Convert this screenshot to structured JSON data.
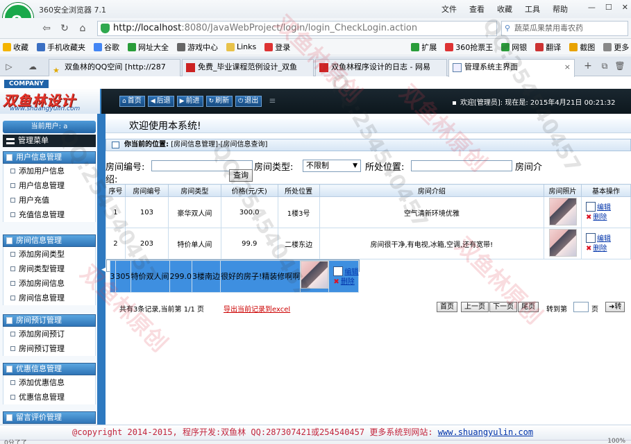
{
  "browser": {
    "app_title": "360安全浏览器 7.1",
    "menu": [
      "文件",
      "查看",
      "收藏",
      "工具",
      "帮助"
    ],
    "url_host": "http://localhost",
    "url_rest": ":8080/JavaWebProject/login/login_CheckLogin.action",
    "search_placeholder": "蔬菜瓜果禁用毒农药",
    "bookmarks": [
      "收藏",
      "手机收藏夹",
      "谷歌",
      "网址大全",
      "游戏中心",
      "Links",
      "登录",
      "扩展",
      "360抢票王",
      "网银",
      "翻译",
      "截图",
      "更多"
    ],
    "tabs": [
      {
        "label": "双鱼林的QQ空间 [http://287"
      },
      {
        "label": "免费_毕业课程范例设计_双鱼"
      },
      {
        "label": "双鱼林程序设计的日志 - 网易"
      },
      {
        "label": "管理系统主界面"
      }
    ]
  },
  "header": {
    "company_tag": "COMPANY",
    "brand_name": "双鱼林设计",
    "brand_url": "www.shuangyulin.com",
    "nav": [
      "首页",
      "后退",
      "前进",
      "刷新",
      "退出"
    ],
    "welcome": "欢迎[管理员]:  现在是: 2015年4月21日 00:21:32"
  },
  "sidebar": {
    "current_user_label": "当前用户: a",
    "menu_title": "管理菜单",
    "groups": [
      {
        "title": "用户信息管理",
        "items": [
          "添加用户信息",
          "用户信息管理",
          "用户充值",
          "充值信息管理"
        ]
      },
      {
        "title": "房间信息管理",
        "items": [
          "添加房间类型",
          "房间类型管理",
          "添加房间信息",
          "房间信息管理"
        ]
      },
      {
        "title": "房间预订管理",
        "items": [
          "添加房间预订",
          "房间预订管理"
        ]
      },
      {
        "title": "优惠信息管理",
        "items": [
          "添加优惠信息",
          "优惠信息管理"
        ]
      },
      {
        "title": "留言评价管理",
        "items": []
      }
    ]
  },
  "main": {
    "welcome_text": "欢迎使用本系统!",
    "position_label": "你当前的位置:",
    "position_path": "[房间信息管理]-[房间信息查询]",
    "search": {
      "room_no_label": "房间编号:",
      "room_type_label": "房间类型:",
      "room_type_value": "不限制",
      "location_label": "所处位置:",
      "intro_label_1": "房间介",
      "intro_label_2": "绍:",
      "query_button": "查询"
    },
    "table": {
      "headers": [
        "序号",
        "房间编号",
        "房间类型",
        "价格(元/天)",
        "所处位置",
        "房间介绍",
        "房间照片",
        "基本操作"
      ],
      "rows": [
        {
          "seq": "1",
          "room_no": "103",
          "type": "豪华双人间",
          "price": "300.0",
          "location": "1楼3号",
          "intro": "空气清新环境优雅"
        },
        {
          "seq": "2",
          "room_no": "203",
          "type": "特价单人间",
          "price": "99.9",
          "location": "二楼东边",
          "intro": "房间很干净,有电视,冰箱,空调,还有宽带!"
        },
        {
          "seq": "3",
          "room_no": "305",
          "type": "特价双人间",
          "price": "299.0",
          "location": "3楼南边",
          "intro": "很好的房子!精装修啊啊"
        }
      ],
      "edit_label": "编辑",
      "delete_label": "删除"
    },
    "pager": {
      "info": "共有3条记录,当前第 1/1 页",
      "export": "导出当前记录到excel",
      "buttons": [
        "首页",
        "上一页",
        "下一页",
        "尾页"
      ],
      "goto_label": "转到第",
      "page_label": "页",
      "go_button": "转"
    }
  },
  "footer": {
    "copyright": "@copyright 2014-2015, 程序开发:双鱼林  QQ:287307421或254540457  更多系统到网站:",
    "link": "www.shuangyulin.com"
  },
  "status": {
    "left": "0分了了",
    "right": "100%"
  }
}
